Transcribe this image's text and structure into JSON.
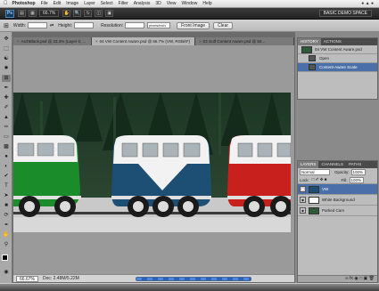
{
  "menubar": {
    "app": "Photoshop",
    "items": [
      "File",
      "Edit",
      "Image",
      "Layer",
      "Select",
      "Filter",
      "Analysis",
      "3D",
      "View",
      "Window",
      "Help"
    ]
  },
  "appbar": {
    "logo": "Ps",
    "zoom": "66.7%",
    "workspace": "BASIC DEMO SPACE"
  },
  "options": {
    "width_label": "Width:",
    "height_label": "Height:",
    "resolution_label": "Resolution:",
    "units": "pixels/inch",
    "front_image_button": "Front Image",
    "clear_button": "Clear"
  },
  "tabs": [
    {
      "label": "ArchBlack.psd @ 33.3% (Layer 0, ..."
    },
    {
      "label": "04 VW Content Aware.psd @ 66.7% (VW, RGB/8*)"
    },
    {
      "label": "03 Golf Content Aware.psd @ 50..."
    }
  ],
  "window_title": "04 VW Content Aware.psd @ 66.7% (VW, RGB/8*) *",
  "status": {
    "zoom": "66.67%",
    "doc": "Doc: 2.48M/5.22M"
  },
  "history": {
    "tabs": [
      "HISTORY",
      "ACTIONS"
    ],
    "snapshot": "04 VW Content Aware.psd",
    "items": [
      {
        "label": "Open"
      },
      {
        "label": "Content-Aware Scale"
      }
    ]
  },
  "layers": {
    "tabs": [
      "LAYERS",
      "CHANNELS",
      "PATHS"
    ],
    "blend_mode": "Normal",
    "opacity_label": "Opacity:",
    "opacity": "100%",
    "fill_label": "Fill:",
    "fill": "100%",
    "lock_label": "Lock:",
    "items": [
      {
        "label": "VW"
      },
      {
        "label": "White Background"
      },
      {
        "label": "Parked Cars"
      }
    ]
  },
  "colors": {
    "selection": "#4b6fa8",
    "bus_green": "#1a8c2a",
    "bus_blue": "#1d4e74",
    "bus_red": "#c8201c"
  }
}
